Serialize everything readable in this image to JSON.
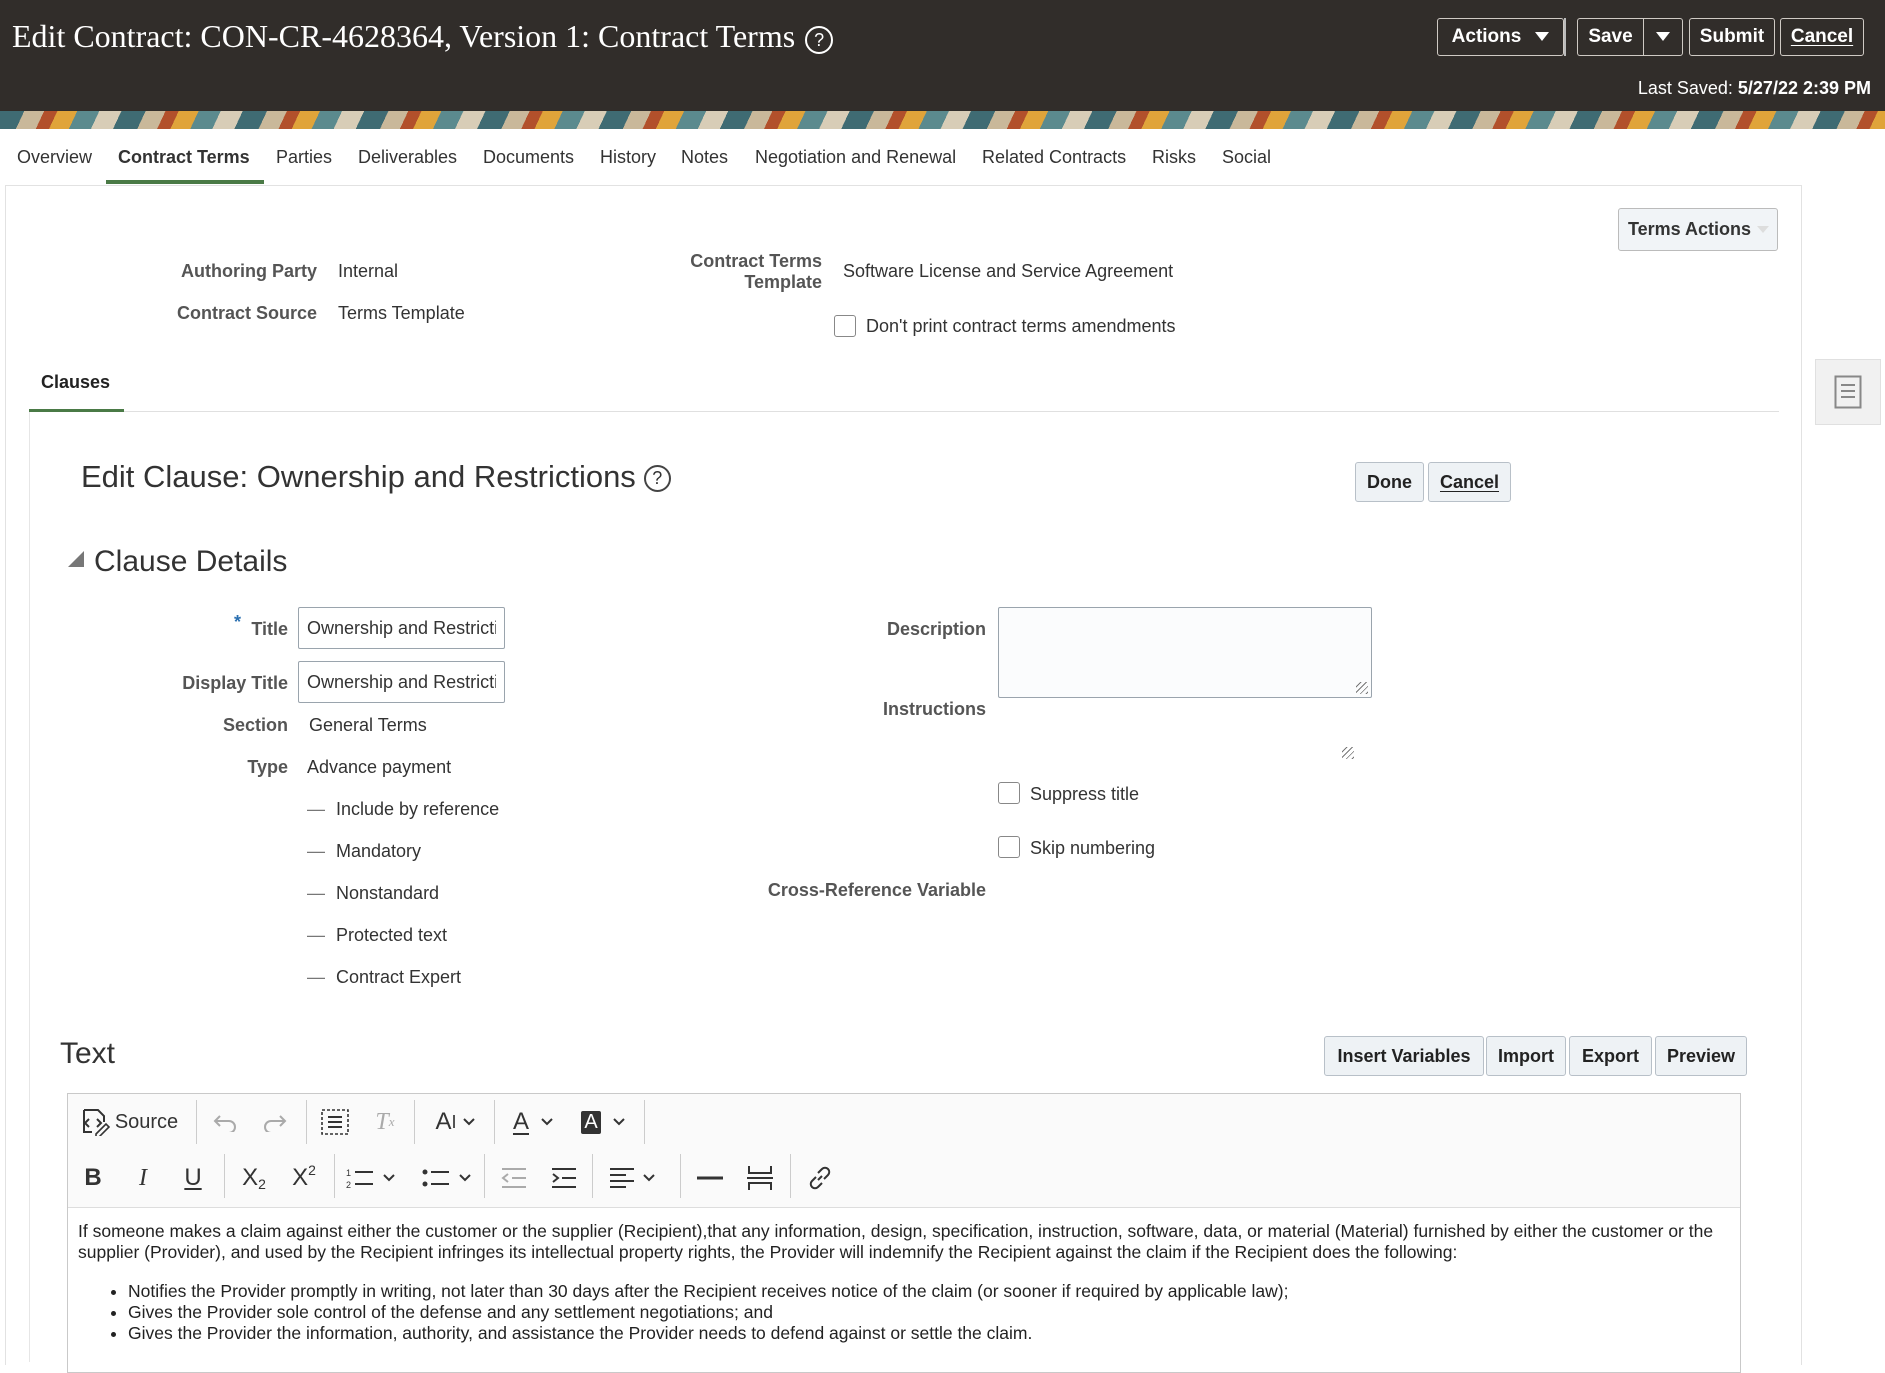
{
  "header": {
    "title": "Edit Contract: CON-CR-4628364, Version 1: Contract Terms",
    "help_glyph": "?",
    "actions_label": "Actions",
    "save_label": "Save",
    "submit_label": "Submit",
    "cancel_label": "Cancel",
    "last_saved_label": "Last Saved:",
    "last_saved_value": "5/27/22 2:39 PM"
  },
  "tabs": [
    {
      "label": "Overview"
    },
    {
      "label": "Contract Terms"
    },
    {
      "label": "Parties"
    },
    {
      "label": "Deliverables"
    },
    {
      "label": "Documents"
    },
    {
      "label": "History"
    },
    {
      "label": "Notes"
    },
    {
      "label": "Negotiation and Renewal"
    },
    {
      "label": "Related Contracts"
    },
    {
      "label": "Risks"
    },
    {
      "label": "Social"
    }
  ],
  "terms": {
    "actions_label": "Terms Actions",
    "authoring_party_label": "Authoring Party",
    "authoring_party_value": "Internal",
    "contract_source_label": "Contract Source",
    "contract_source_value": "Terms Template",
    "template_label_line1": "Contract Terms",
    "template_label_line2": "Template",
    "template_value": "Software License and Service Agreement",
    "dont_print_label": "Don't print contract terms amendments"
  },
  "clauses_tab": "Clauses",
  "clause": {
    "edit_title": "Edit Clause: Ownership and Restrictions",
    "done_label": "Done",
    "cancel_label": "Cancel",
    "section_title": "Clause Details",
    "required_mark": "*",
    "title_label": "Title",
    "title_value": "Ownership and Restrictions",
    "display_title_label": "Display Title",
    "display_title_value": "Ownership and Restrictions",
    "section_label": "Section",
    "section_value": "General Terms",
    "type_label": "Type",
    "type_value": "Advance payment",
    "flag_dash": "—",
    "flags": [
      "Include by reference",
      "Mandatory",
      "Nonstandard",
      "Protected text",
      "Contract Expert"
    ],
    "description_label": "Description",
    "instructions_label": "Instructions",
    "suppress_title_label": "Suppress title",
    "skip_numbering_label": "Skip numbering",
    "cross_ref_label": "Cross-Reference Variable"
  },
  "text_section": {
    "title": "Text",
    "insert_variables_label": "Insert Variables",
    "import_label": "Import",
    "export_label": "Export",
    "preview_label": "Preview",
    "source_label": "Source",
    "body_paragraph": "If someone makes a claim against either the customer or the supplier (Recipient),that any information, design, specification, instruction, software, data, or material (Material) furnished by either the customer or the supplier (Provider), and used by the Recipient infringes its intellectual property rights, the Provider will indemnify the Recipient against the claim if the Recipient does the following:",
    "bullets": [
      "Notifies the Provider promptly in writing, not later than 30 days after the Recipient receives notice of the claim (or sooner if required by applicable law);",
      "Gives the Provider sole control of the defense and any settlement negotiations; and",
      "Gives the Provider the information, authority, and assistance the Provider needs to defend against or settle the claim."
    ]
  }
}
